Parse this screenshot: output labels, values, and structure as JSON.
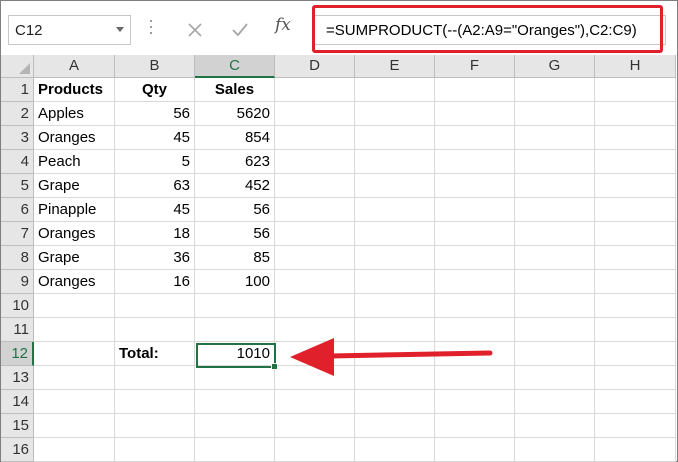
{
  "name_box": {
    "value": "C12"
  },
  "formula_bar": {
    "formula": "=SUMPRODUCT(--(A2:A9=\"Oranges\"),C2:C9)",
    "fx_label": "fx",
    "cancel_icon": "close-icon",
    "enter_icon": "check-icon"
  },
  "columns": [
    "A",
    "B",
    "C",
    "D",
    "E",
    "F",
    "G",
    "H"
  ],
  "selected_column": "C",
  "rows": [
    "1",
    "2",
    "3",
    "4",
    "5",
    "6",
    "7",
    "8",
    "9",
    "10",
    "11",
    "12",
    "13",
    "14",
    "15",
    "16"
  ],
  "selected_row": "12",
  "headers": {
    "products": "Products",
    "qty": "Qty",
    "sales": "Sales"
  },
  "data_rows": [
    {
      "product": "Apples",
      "qty": "56",
      "sales": "5620"
    },
    {
      "product": "Oranges",
      "qty": "45",
      "sales": "854"
    },
    {
      "product": "Peach",
      "qty": "5",
      "sales": "623"
    },
    {
      "product": "Grape",
      "qty": "63",
      "sales": "452"
    },
    {
      "product": "Pinapple",
      "qty": "45",
      "sales": "56"
    },
    {
      "product": "Oranges",
      "qty": "18",
      "sales": "56"
    },
    {
      "product": "Grape",
      "qty": "36",
      "sales": "85"
    },
    {
      "product": "Oranges",
      "qty": "16",
      "sales": "100"
    }
  ],
  "total": {
    "label": "Total:",
    "value": "1010"
  },
  "colors": {
    "highlight": "#e0202b",
    "selection": "#217346",
    "arrow": "#e0202b"
  }
}
